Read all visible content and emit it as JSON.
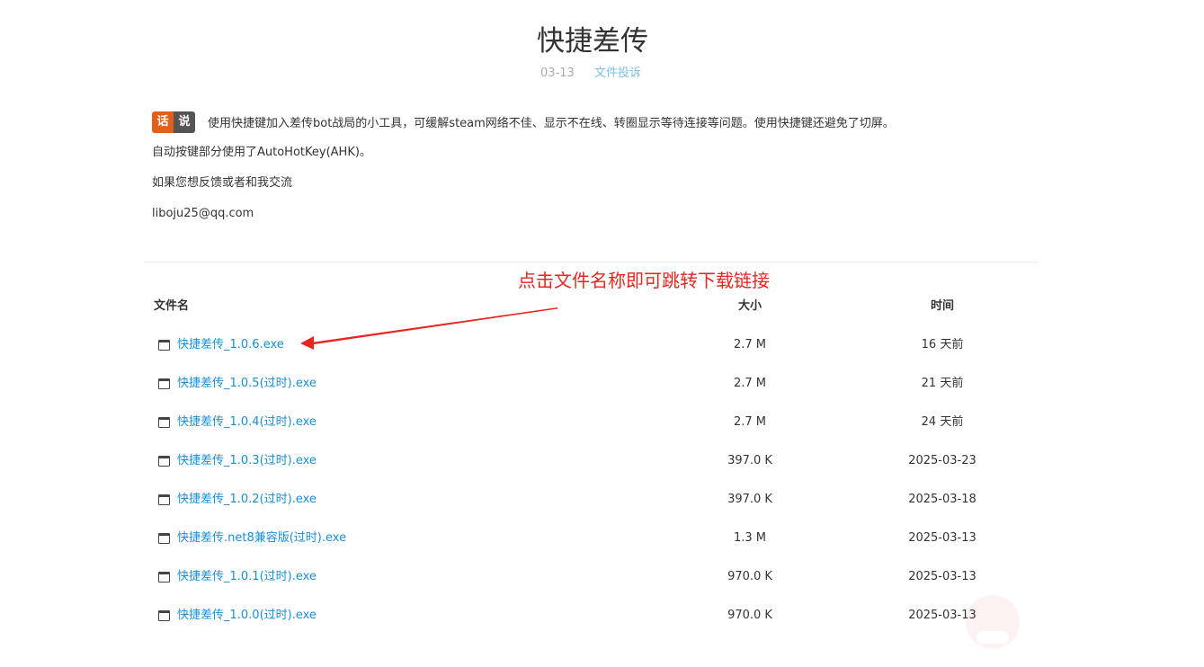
{
  "page": {
    "title": "快捷差传",
    "date": "03-13",
    "report_link": "文件投诉"
  },
  "intro": {
    "badge_left": "话",
    "badge_right": "说",
    "lines": [
      "使用快捷键加入差传bot战局的小工具，可缓解steam网络不佳、显示不在线、转圈显示等待连接等问题。使用快捷键还避免了切屏。",
      "自动按键部分使用了AutoHotKey(AHK)。",
      "如果您想反馈或者和我交流",
      "liboju25@qq.com"
    ]
  },
  "annotation": "点击文件名称即可跳转下载链接",
  "colors": {
    "link": "#1a8fd6",
    "annotation": "#e8261f",
    "badge_left": "#e0601a",
    "badge_right": "#555555"
  },
  "table": {
    "headers": {
      "name": "文件名",
      "size": "大小",
      "time": "时间"
    },
    "rows": [
      {
        "icon": "window-icon",
        "name": "快捷差传_1.0.6.exe",
        "size": "2.7 M",
        "time": "16 天前"
      },
      {
        "icon": "window-icon",
        "name": "快捷差传_1.0.5(过时).exe",
        "size": "2.7 M",
        "time": "21 天前"
      },
      {
        "icon": "window-icon",
        "name": "快捷差传_1.0.4(过时).exe",
        "size": "2.7 M",
        "time": "24 天前"
      },
      {
        "icon": "window-icon",
        "name": "快捷差传_1.0.3(过时).exe",
        "size": "397.0 K",
        "time": "2025-03-23"
      },
      {
        "icon": "window-icon",
        "name": "快捷差传_1.0.2(过时).exe",
        "size": "397.0 K",
        "time": "2025-03-18"
      },
      {
        "icon": "window-icon",
        "name": "快捷差传.net8兼容版(过时).exe",
        "size": "1.3 M",
        "time": "2025-03-13"
      },
      {
        "icon": "window-icon",
        "name": "快捷差传_1.0.1(过时).exe",
        "size": "970.0 K",
        "time": "2025-03-13"
      },
      {
        "icon": "window-icon",
        "name": "快捷差传_1.0.0(过时).exe",
        "size": "970.0 K",
        "time": "2025-03-13"
      }
    ]
  }
}
